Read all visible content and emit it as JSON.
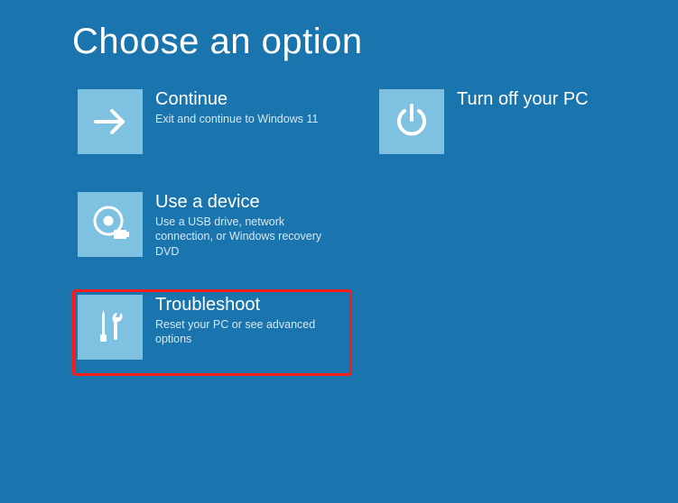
{
  "title": "Choose an option",
  "tiles": {
    "continue": {
      "title": "Continue",
      "desc": "Exit and continue to Windows 11"
    },
    "turnoff": {
      "title": "Turn off your PC",
      "desc": ""
    },
    "device": {
      "title": "Use a device",
      "desc": "Use a USB drive, network connection, or Windows recovery DVD"
    },
    "troubleshoot": {
      "title": "Troubleshoot",
      "desc": "Reset your PC or see advanced options"
    }
  },
  "colors": {
    "background": "#1a74ad",
    "tile_icon_bg": "#7fc1e0",
    "highlight": "#ff1a1a"
  }
}
